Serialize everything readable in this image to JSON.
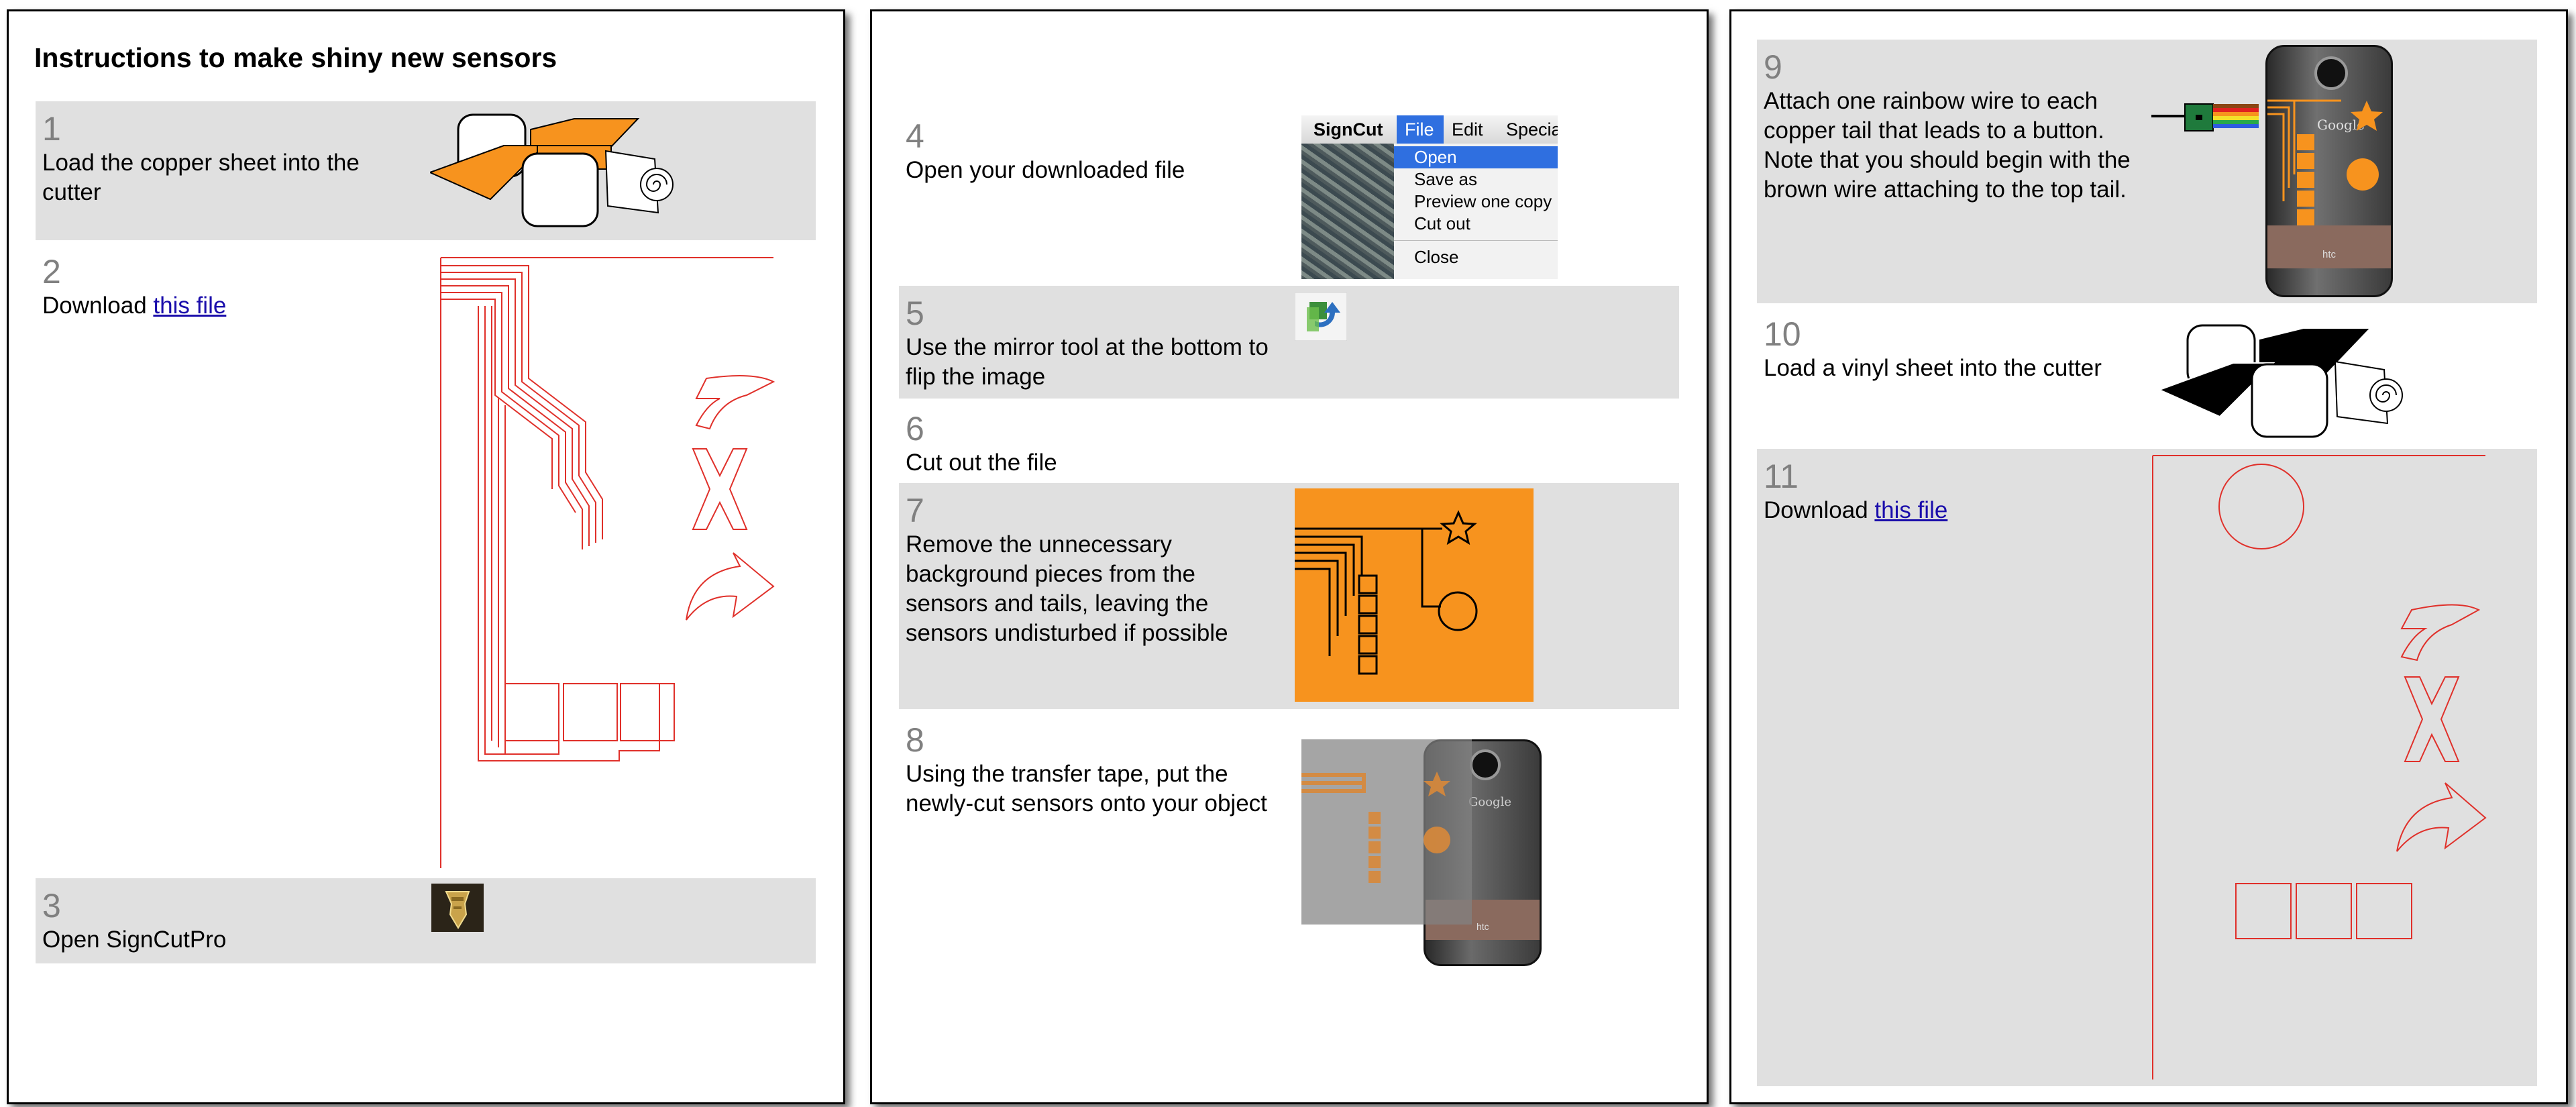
{
  "document": {
    "title": "Instructions to make shiny new sensors",
    "link_text": "this file",
    "colors": {
      "row_gray": "#e0e0e0",
      "step_number": "#808080",
      "cut_red": "#e0302a",
      "copper_orange": "#f7931e",
      "link": "#1a0dab"
    }
  },
  "steps": {
    "s1": {
      "number": "1",
      "text": "Load the copper sheet into the cutter",
      "image": "cutter-icon-copper"
    },
    "s2": {
      "number": "2",
      "text_before": "Download ",
      "link": "this file",
      "image": "cut-file-preview-traces"
    },
    "s3": {
      "number": "3",
      "text": "Open SignCutPro",
      "image": "signcut-app-icon"
    },
    "s4": {
      "number": "4",
      "text": "Open your downloaded file",
      "image": "signcut-file-menu",
      "menu": {
        "app": "SignCut",
        "items": [
          "File",
          "Edit",
          "Specia"
        ],
        "entries": [
          "Open",
          "Save as",
          "Preview one copy",
          "Cut out",
          "Close"
        ]
      }
    },
    "s5": {
      "number": "5",
      "text": "Use the mirror tool at the bottom to flip the image",
      "image": "mirror-tool-icon"
    },
    "s6": {
      "number": "6",
      "text": "Cut out the file"
    },
    "s7": {
      "number": "7",
      "text": "Remove the unnecessary background pieces from the sensors and tails, leaving the sensors undisturbed if possible",
      "image": "weeded-copper-sheet"
    },
    "s8": {
      "number": "8",
      "text": "Using the transfer tape, put the newly-cut sensors onto your object",
      "image": "phone-with-transfer-tape",
      "phone": {
        "brand": "Google",
        "maker": "htc"
      }
    },
    "s9": {
      "number": "9",
      "text": "Attach one rainbow wire to each copper tail that leads to a button. Note that you should begin with the brown wire attaching to the top tail.",
      "image": "phone-with-rainbow-wires",
      "phone": {
        "brand": "Google",
        "maker": "htc"
      }
    },
    "s10": {
      "number": "10",
      "text": "Load a vinyl sheet into the cutter",
      "image": "cutter-icon-vinyl"
    },
    "s11": {
      "number": "11",
      "text_before": "Download ",
      "link": "this file",
      "image": "cut-file-preview-vinyl"
    }
  }
}
